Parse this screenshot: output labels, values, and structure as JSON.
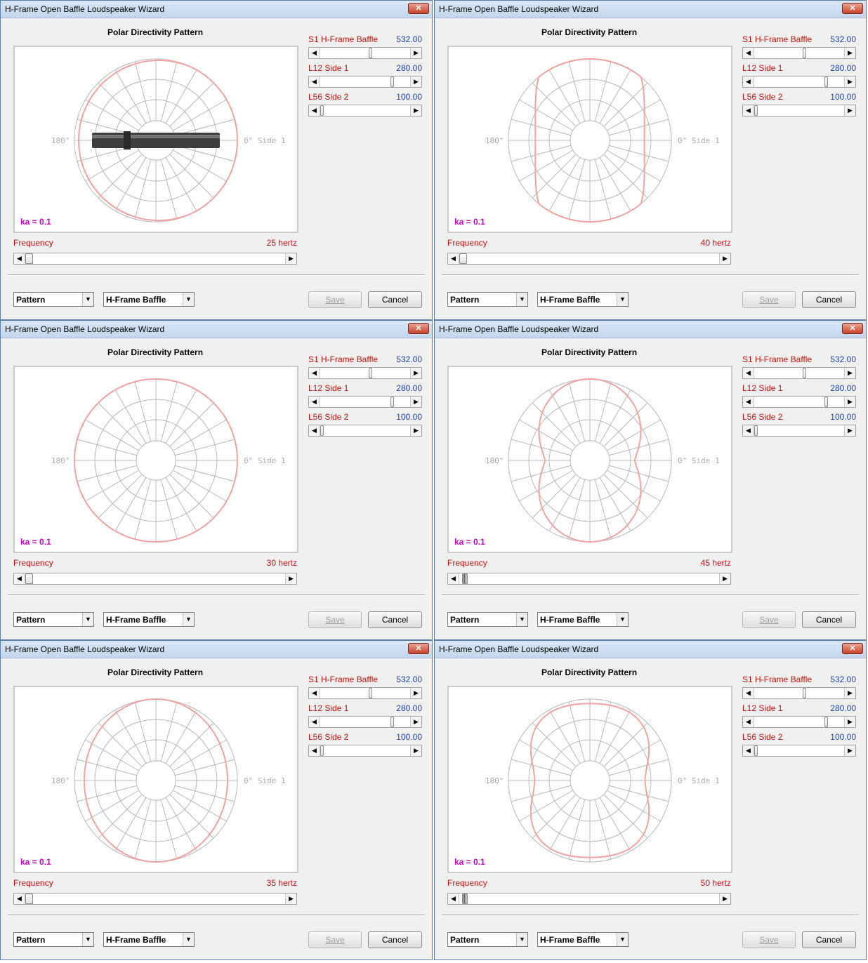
{
  "common": {
    "window_title": "H-Frame Open Baffle Loudspeaker Wizard",
    "close_glyph": "✕",
    "chart_title": "Polar Directivity Pattern",
    "angle_left": "180°",
    "angle_right": "0° Side 1",
    "ka_label": "ka = 0.1",
    "frequency_label": "Frequency",
    "s1_label": "S1  H-Frame Baffle",
    "s1_value": "532.00",
    "l12_label": "L12  Side 1",
    "l12_value": "280.00",
    "l56_label": "L56  Side 2",
    "l56_value": "100.00",
    "view_select": "Pattern",
    "model_select": "H-Frame Baffle",
    "save_label": "Save",
    "cancel_label": "Cancel",
    "colors": {
      "pattern": "#f4a0a0",
      "grid": "#b8b8b8",
      "ka": "#cc00cc",
      "label_red": "#cc1111",
      "value_blue": "#1f3fb5"
    }
  },
  "windows": [
    {
      "frequency": "25 hertz",
      "shape": "cardioid-wide",
      "baffle_image": true,
      "freq_thumb_hatched": false
    },
    {
      "frequency": "40 hertz",
      "shape": "dipole-soft",
      "baffle_image": false,
      "freq_thumb_hatched": false
    },
    {
      "frequency": "30 hertz",
      "shape": "omni",
      "baffle_image": false,
      "freq_thumb_hatched": false
    },
    {
      "frequency": "45 hertz",
      "shape": "dipole-notch",
      "baffle_image": false,
      "freq_thumb_hatched": true
    },
    {
      "frequency": "35 hertz",
      "shape": "oval",
      "baffle_image": false,
      "freq_thumb_hatched": false
    },
    {
      "frequency": "50 hertz",
      "shape": "dipole-lobes",
      "baffle_image": false,
      "freq_thumb_hatched": true
    }
  ]
}
